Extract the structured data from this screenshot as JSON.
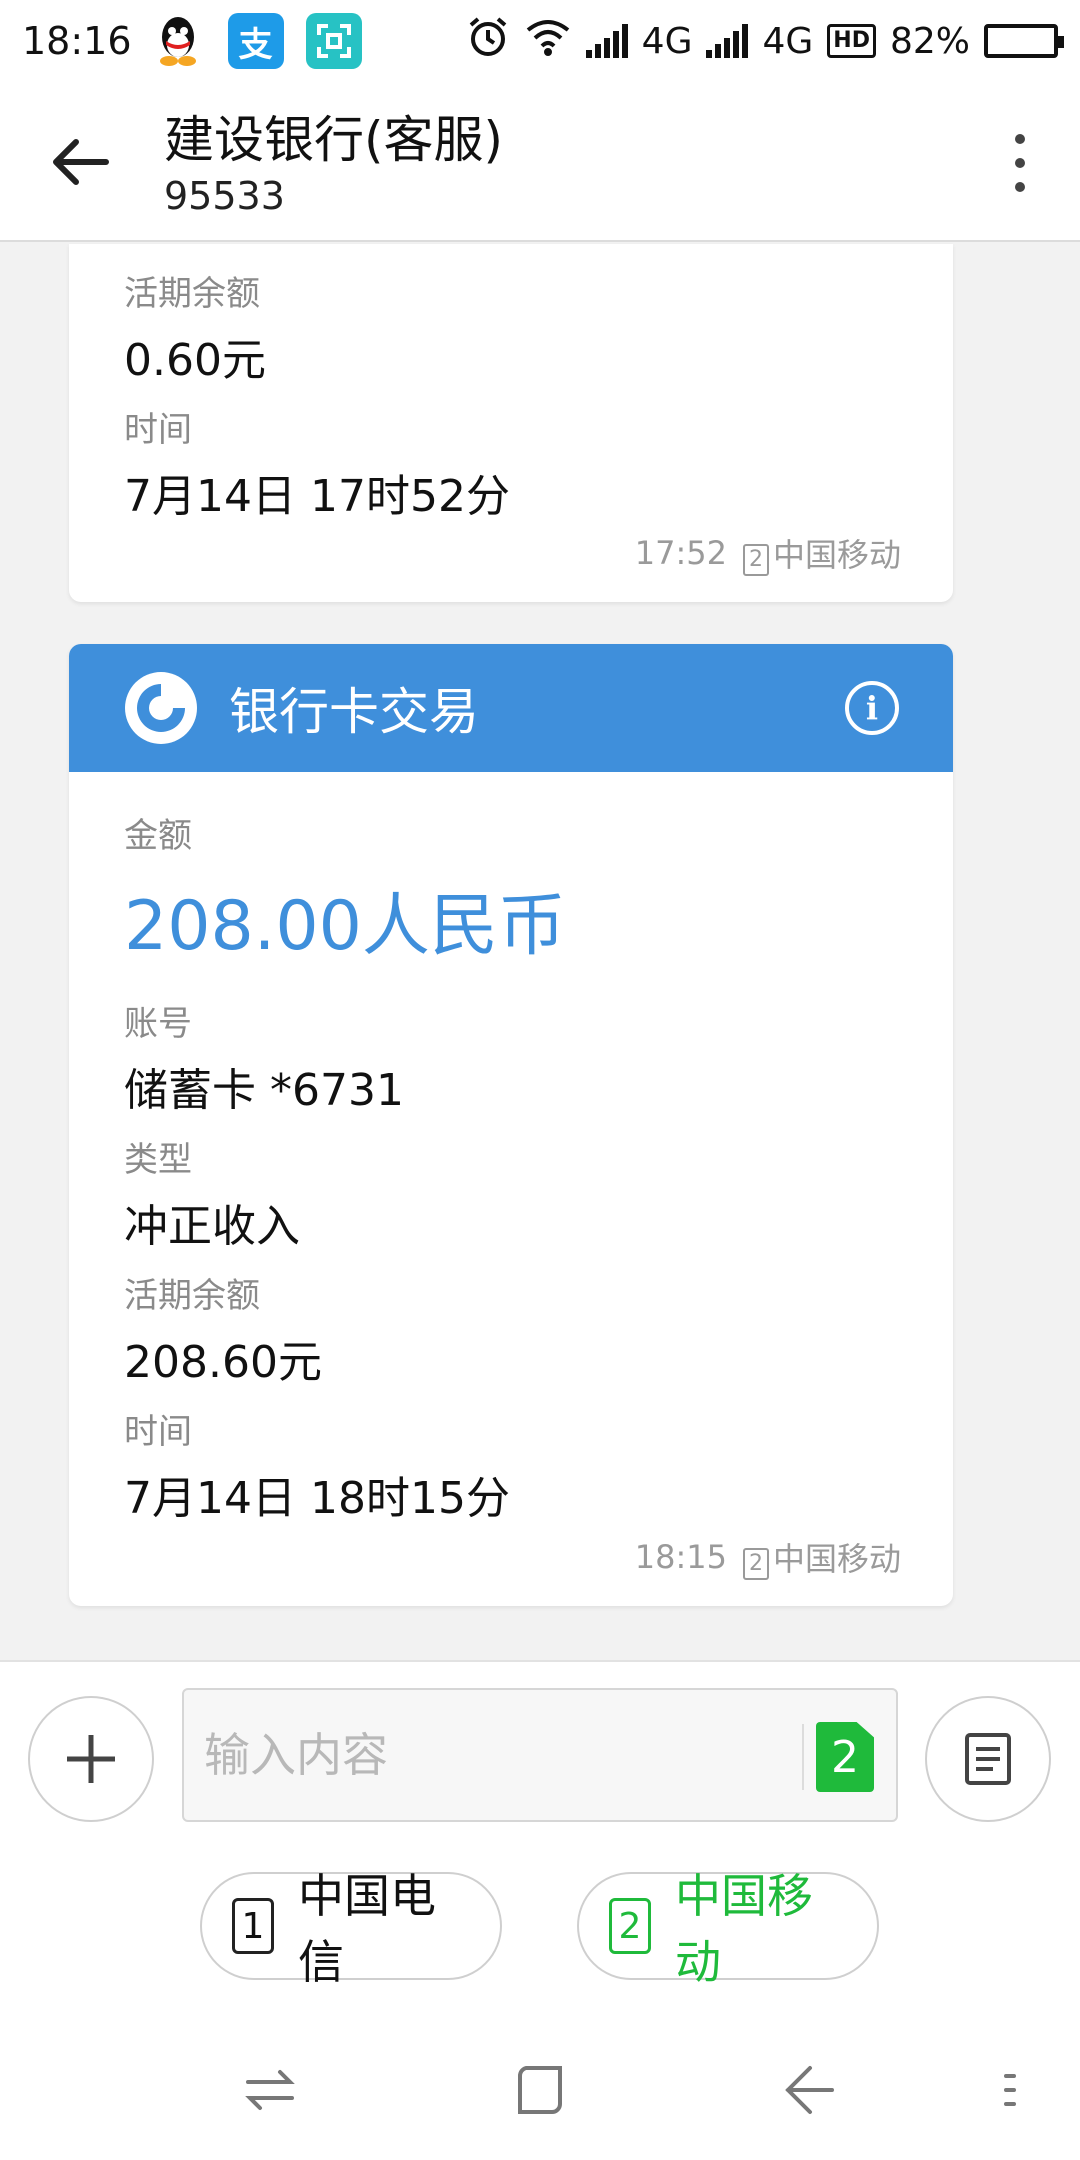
{
  "status_bar": {
    "time": "18:16",
    "network1": "4G",
    "network2": "4G",
    "hd": "HD",
    "battery": "82%",
    "battery_level": 0.82,
    "apps": [
      "qq-icon",
      "alipay-icon",
      "scan-icon"
    ]
  },
  "header": {
    "title": "建设银行(客服)",
    "number": "95533"
  },
  "message1": {
    "balance_label": "活期余额",
    "balance_value": "0.60元",
    "time_label": "时间",
    "time_value": "7月14日 17时52分",
    "sent_time": "17:52",
    "sim_num": "2",
    "carrier": "中国移动"
  },
  "message2": {
    "card_title": "银行卡交易",
    "amount_label": "金额",
    "amount_value": "208.00人民币",
    "account_label": "账号",
    "account_value": "储蓄卡 *6731",
    "type_label": "类型",
    "type_value": "冲正收入",
    "balance_label": "活期余额",
    "balance_value": "208.60元",
    "time_label": "时间",
    "time_value": "7月14日 18时15分",
    "sent_time": "18:15",
    "sim_num": "2",
    "carrier": "中国移动"
  },
  "composer": {
    "placeholder": "输入内容",
    "send_sim": "2"
  },
  "sim_selector": [
    {
      "num": "1",
      "label": "中国电信"
    },
    {
      "num": "2",
      "label": "中国移动"
    }
  ],
  "colors": {
    "accent": "#3f8fdb",
    "sim_green": "#1fba3b"
  }
}
